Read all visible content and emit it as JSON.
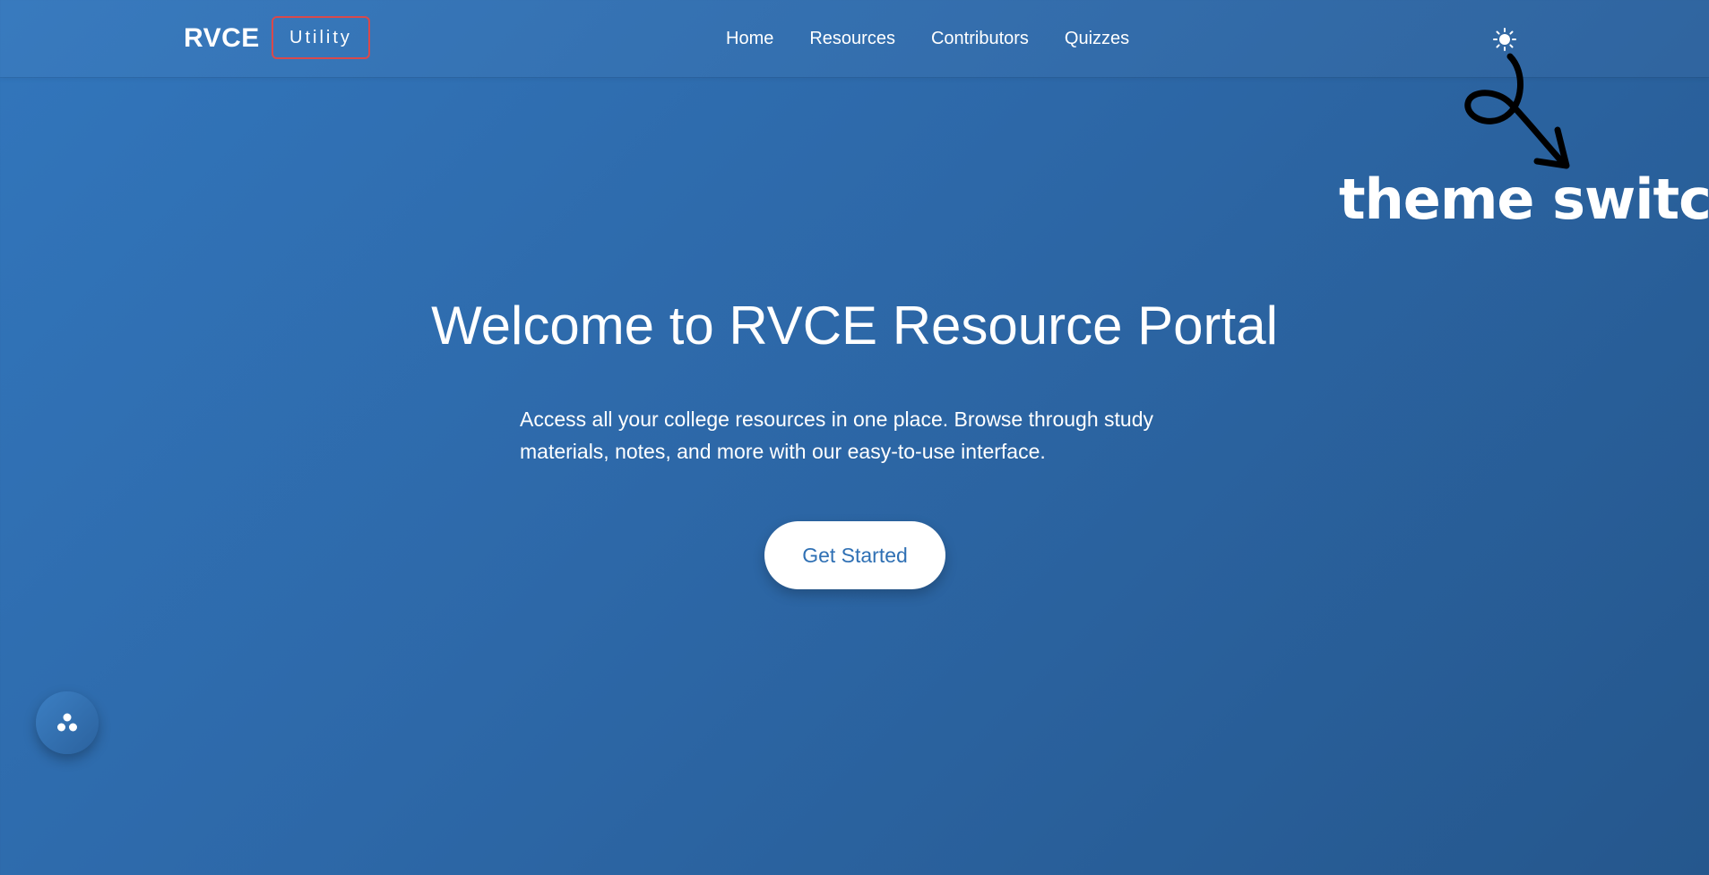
{
  "navbar": {
    "brand": "RVCE",
    "badge": "Utility",
    "links": [
      "Home",
      "Resources",
      "Contributors",
      "Quizzes"
    ],
    "theme_toggle_icon": "sun-icon"
  },
  "annotation": {
    "text": "theme switch",
    "arrow_icon": "curved-arrow-icon"
  },
  "hero": {
    "title": "Welcome to RVCE Resource Portal",
    "subtitle": "Access all your college resources in one place. Browse through study materials, notes, and more with our easy-to-use interface.",
    "cta_label": "Get Started"
  },
  "fab": {
    "icon": "share-dots-icon"
  },
  "colors": {
    "background_start": "#3276bc",
    "background_end": "#25578d",
    "badge_border": "#d9494b",
    "cta_text": "#2f70b4"
  }
}
